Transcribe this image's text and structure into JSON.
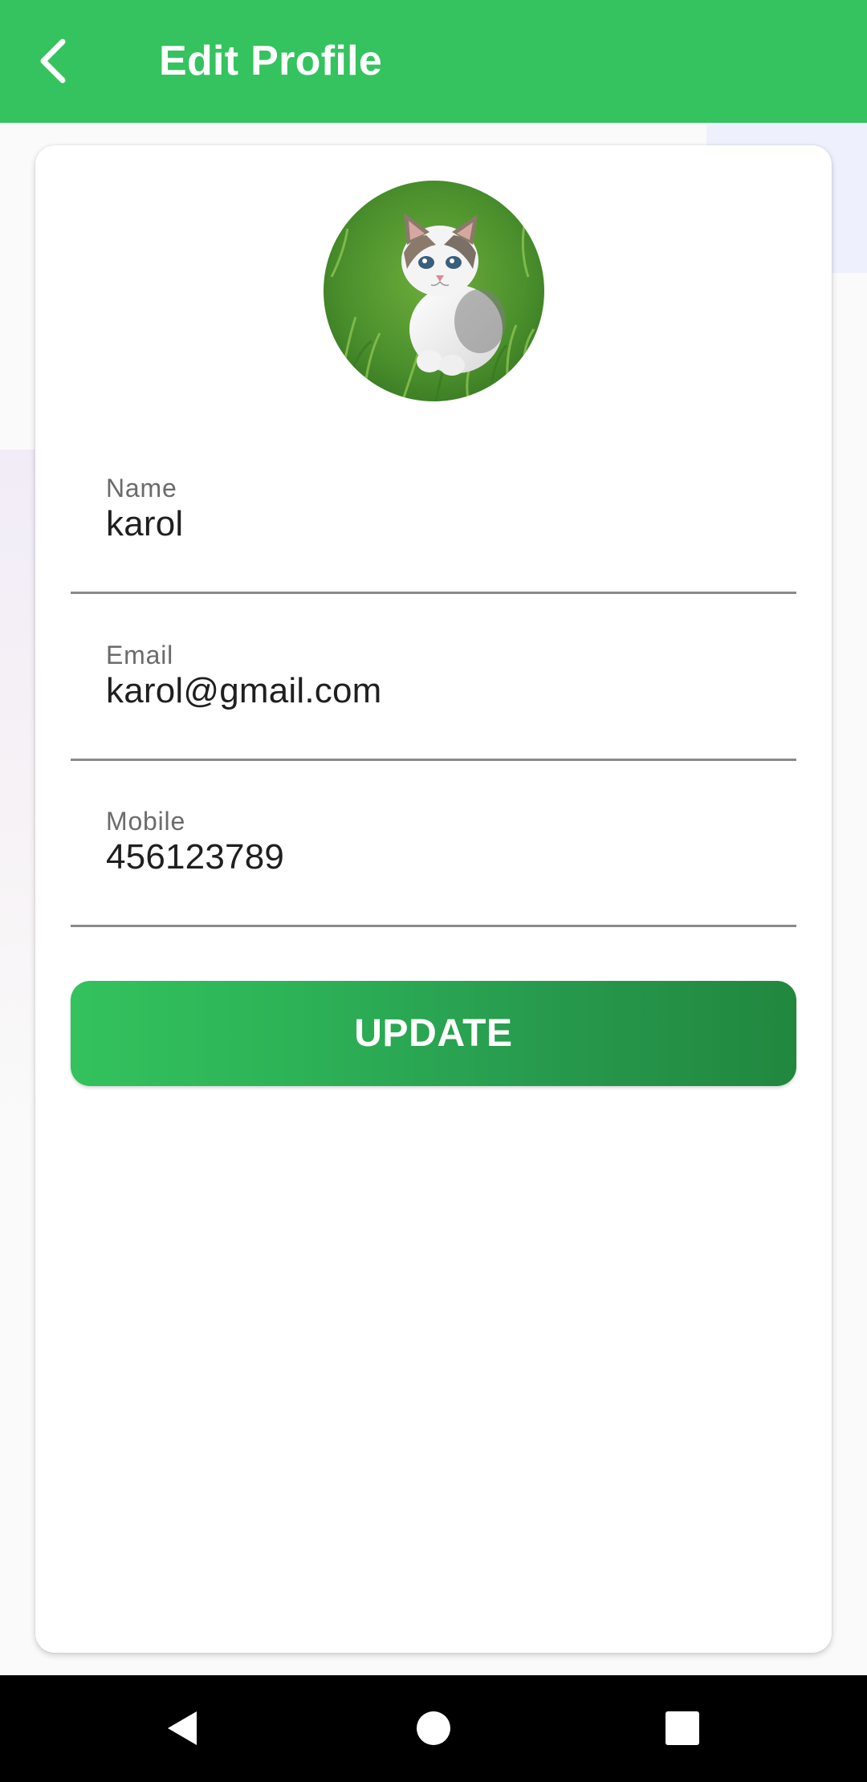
{
  "app_bar": {
    "title": "Edit Profile",
    "back_icon": "chevron-left-icon",
    "color": "#34c35e"
  },
  "profile": {
    "avatar_description": "kitten-on-grass-photo"
  },
  "fields": [
    {
      "label": "Name",
      "value": "karol"
    },
    {
      "label": "Email",
      "value": "karol@gmail.com"
    },
    {
      "label": "Mobile",
      "value": "456123789"
    }
  ],
  "update_button": {
    "label": "UPDATE",
    "gradient_start": "#33c25d",
    "gradient_end": "#21873f"
  },
  "system_nav": {
    "back_icon": "triangle-back-icon",
    "home_icon": "circle-home-icon",
    "recents_icon": "square-recents-icon"
  }
}
